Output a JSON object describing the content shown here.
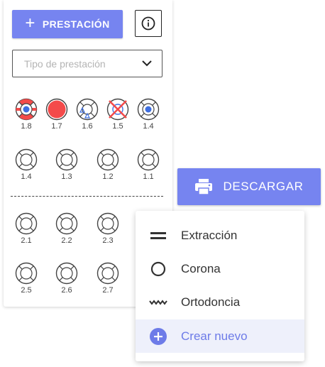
{
  "toolbar": {
    "add_label": "PRESTACIÓN",
    "download_label": "DESCARGAR"
  },
  "filter": {
    "placeholder": "Tipo de prestación"
  },
  "teeth_row1": [
    {
      "num": "1.8",
      "state": "red-full"
    },
    {
      "num": "1.7",
      "state": "red-solid"
    },
    {
      "num": "1.6",
      "state": "blue-triangles"
    },
    {
      "num": "1.5",
      "state": "red-cross"
    },
    {
      "num": "1.4",
      "state": "blue-center"
    }
  ],
  "teeth_row2": [
    "1.4",
    "1.3",
    "1.2",
    "1.1"
  ],
  "teeth_row3": [
    "2.1",
    "2.2",
    "2.3"
  ],
  "teeth_row4": [
    "2.5",
    "2.6",
    "2.7"
  ],
  "menu": {
    "items": [
      {
        "label": "Extracción",
        "icon": "equals-icon"
      },
      {
        "label": "Corona",
        "icon": "circle-icon"
      },
      {
        "label": "Ortodoncia",
        "icon": "wave-icon"
      },
      {
        "label": "Crear nuevo",
        "icon": "add-circle-icon"
      }
    ]
  },
  "colors": {
    "accent": "#7684f0",
    "red": "#f44a4a",
    "blue": "#3f6fe0"
  }
}
